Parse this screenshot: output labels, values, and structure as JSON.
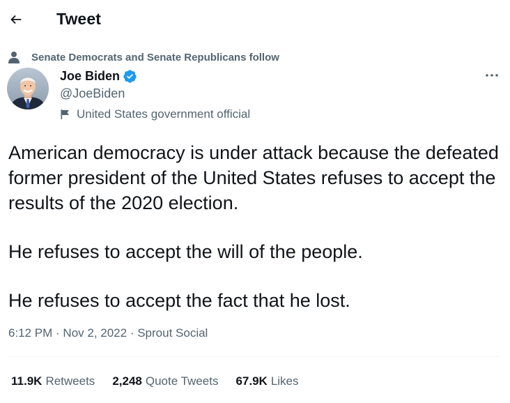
{
  "header": {
    "title": "Tweet",
    "back_icon": "arrow-left-icon"
  },
  "social_context": {
    "text": "Senate Democrats and Senate Republicans follow",
    "icon": "person-icon"
  },
  "author": {
    "name": "Joe Biden",
    "handle": "@JoeBiden",
    "verified": true,
    "verified_color": "#1d9bf0",
    "label": "United States government official",
    "label_icon": "flag-icon"
  },
  "tweet": {
    "paragraphs": [
      "American democracy is under attack because the defeated former president of the United States refuses to accept the results of the 2020 election.",
      "He refuses to accept the will of the people.",
      "He refuses to accept the fact that he lost."
    ],
    "time": "6:12 PM",
    "separator": " · ",
    "date": "Nov 2, 2022",
    "source": "Sprout Social"
  },
  "stats": {
    "retweets_count": "11.9K",
    "retweets_label": "Retweets",
    "quotes_count": "2,248",
    "quotes_label": "Quote Tweets",
    "likes_count": "67.9K",
    "likes_label": "Likes"
  },
  "colors": {
    "text_primary": "#0f1419",
    "text_secondary": "#536471",
    "divider": "#eff3f4",
    "accent": "#1d9bf0"
  }
}
